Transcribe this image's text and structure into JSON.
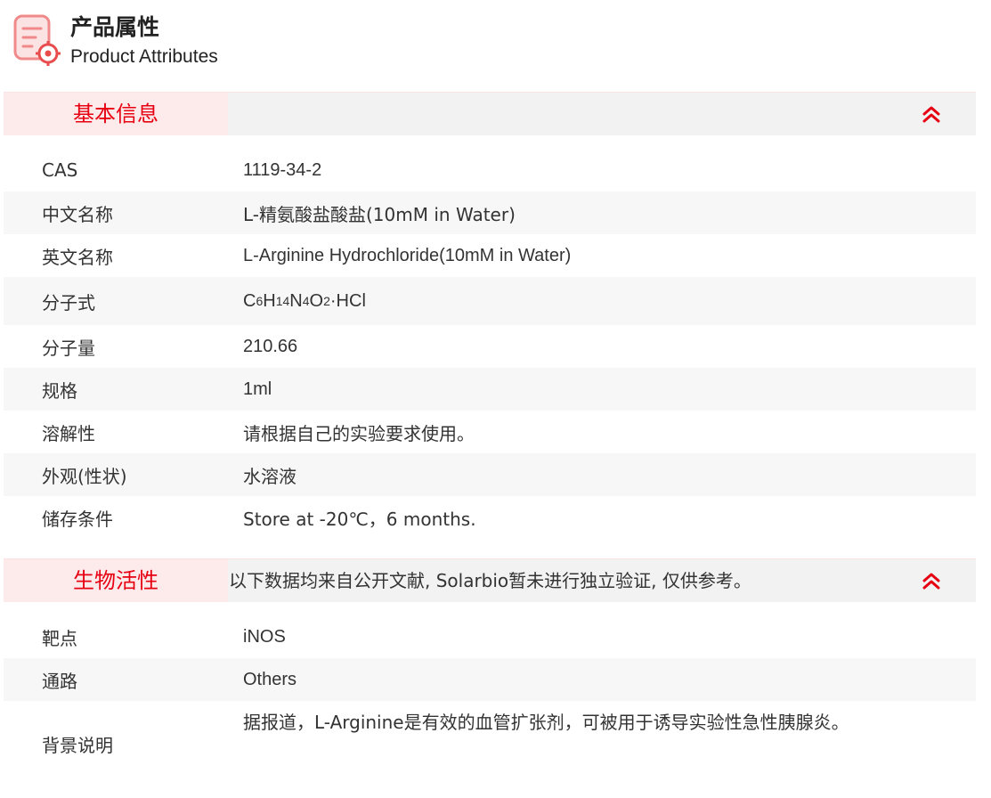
{
  "header": {
    "icon": "document-settings-icon",
    "title_cn": "产品属性",
    "title_en": "Product Attributes"
  },
  "basic": {
    "tab_label": "基本信息",
    "collapse_icon": "double-chevron-up-icon",
    "rows": [
      {
        "label": "CAS",
        "value": "1119-34-2"
      },
      {
        "label": "中文名称",
        "value": "L-精氨酸盐酸盐(10mM in Water)"
      },
      {
        "label": "英文名称",
        "value": "L-Arginine Hydrochloride(10mM in Water)"
      },
      {
        "label": "分子式",
        "formula": {
          "c": "C",
          "c_n": "6",
          "h": "H",
          "h_n": "14",
          "n": "N",
          "n_n": "4",
          "o": "O",
          "o_n": "2",
          "suffix": "·HCl"
        }
      },
      {
        "label": "分子量",
        "value": "210.66"
      },
      {
        "label": "规格",
        "value": "1ml"
      },
      {
        "label": "溶解性",
        "value": "请根据自己的实验要求使用。"
      },
      {
        "label": "外观(性状)",
        "value": "水溶液"
      },
      {
        "label": "储存条件",
        "value": "Store at -20℃，6 months."
      }
    ]
  },
  "bio": {
    "tab_label": "生物活性",
    "note": "以下数据均来自公开文献, Solarbio暂未进行独立验证, 仅供参考。",
    "collapse_icon": "double-chevron-up-icon",
    "rows": [
      {
        "label": "靶点",
        "value": "iNOS"
      },
      {
        "label": "通路",
        "value": "Others"
      },
      {
        "label": "背景说明",
        "value": "据报道，L-Arginine是有效的血管扩张剂，可被用于诱导实验性急性胰腺炎。"
      }
    ]
  },
  "colors": {
    "accent": "#e60012",
    "tab_bg": "#fdebeb",
    "bar_bg": "#f2f2f2",
    "row_alt_bg": "#f7f7f7"
  }
}
